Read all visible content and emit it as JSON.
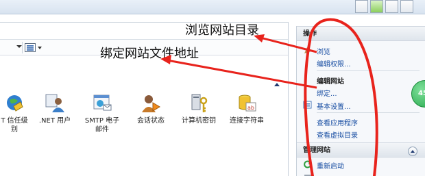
{
  "annotations": {
    "browse_note": "浏览网站目录",
    "binding_note": "绑定网站文件地址"
  },
  "features": [
    {
      "label": "T 信任级\n别",
      "icon": "trust-level-icon"
    },
    {
      "label": ".NET 用户",
      "icon": "dotnet-users-icon"
    },
    {
      "label": "SMTP 电子\n邮件",
      "icon": "smtp-email-icon"
    },
    {
      "label": "会话状态",
      "icon": "session-state-icon"
    },
    {
      "label": "计算机密钥",
      "icon": "machine-key-icon"
    },
    {
      "label": "连接字符串",
      "icon": "connection-strings-icon"
    }
  ],
  "actions": {
    "header": "操作",
    "browse": "浏览",
    "edit_permissions": "编辑权限...",
    "edit_site_header": "编辑网站",
    "bindings": "绑定...",
    "basic_settings": "基本设置...",
    "view_applications": "查看应用程序",
    "view_virtual_dirs": "查看虚拟目录",
    "manage_site_header": "管理网站",
    "restart": "重新启动"
  },
  "colors": {
    "link": "#1a4fa3",
    "annotation_stroke": "#e8231c"
  }
}
